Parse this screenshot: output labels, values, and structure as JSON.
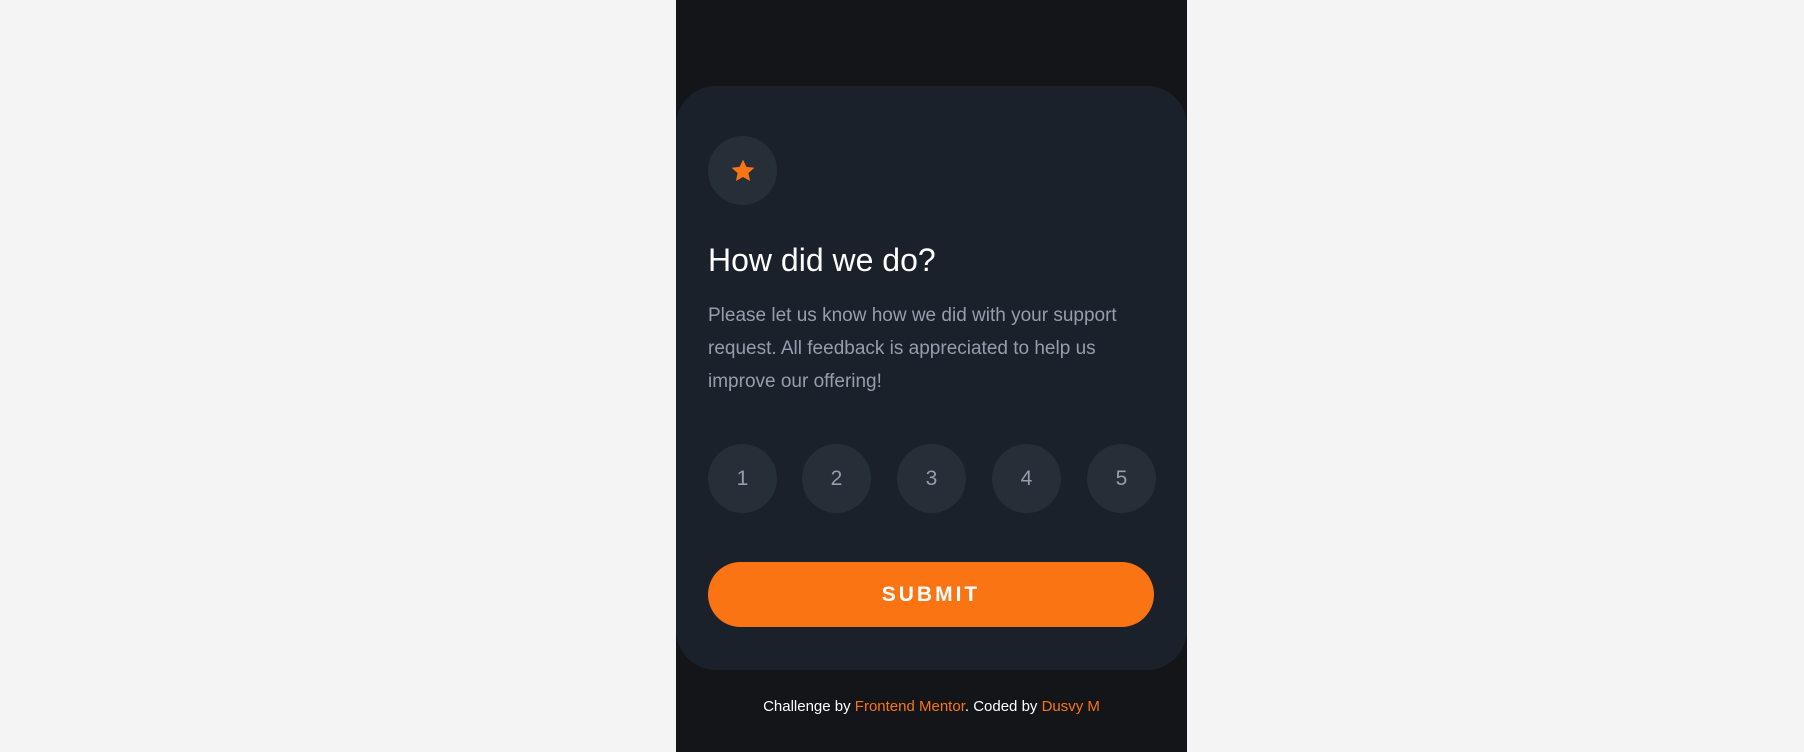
{
  "colors": {
    "page_background": "#f4f4f4",
    "frame_background": "#131518",
    "card_background": "#1b212b",
    "circle_background": "#262e38",
    "accent": "#fb7413",
    "title_text": "#ffffff",
    "body_text": "#959eac"
  },
  "card": {
    "icon": "star-icon",
    "title": "How did we do?",
    "description": "Please let us know how we did with your support request. All feedback is appreciated to help us improve our offering!",
    "ratings": [
      "1",
      "2",
      "3",
      "4",
      "5"
    ],
    "submit_label": "SUBMIT"
  },
  "attribution": {
    "prefix": "Challenge by ",
    "mentor_link": "Frontend Mentor",
    "middle": ". Coded by ",
    "author_link": "Dusvy M"
  }
}
